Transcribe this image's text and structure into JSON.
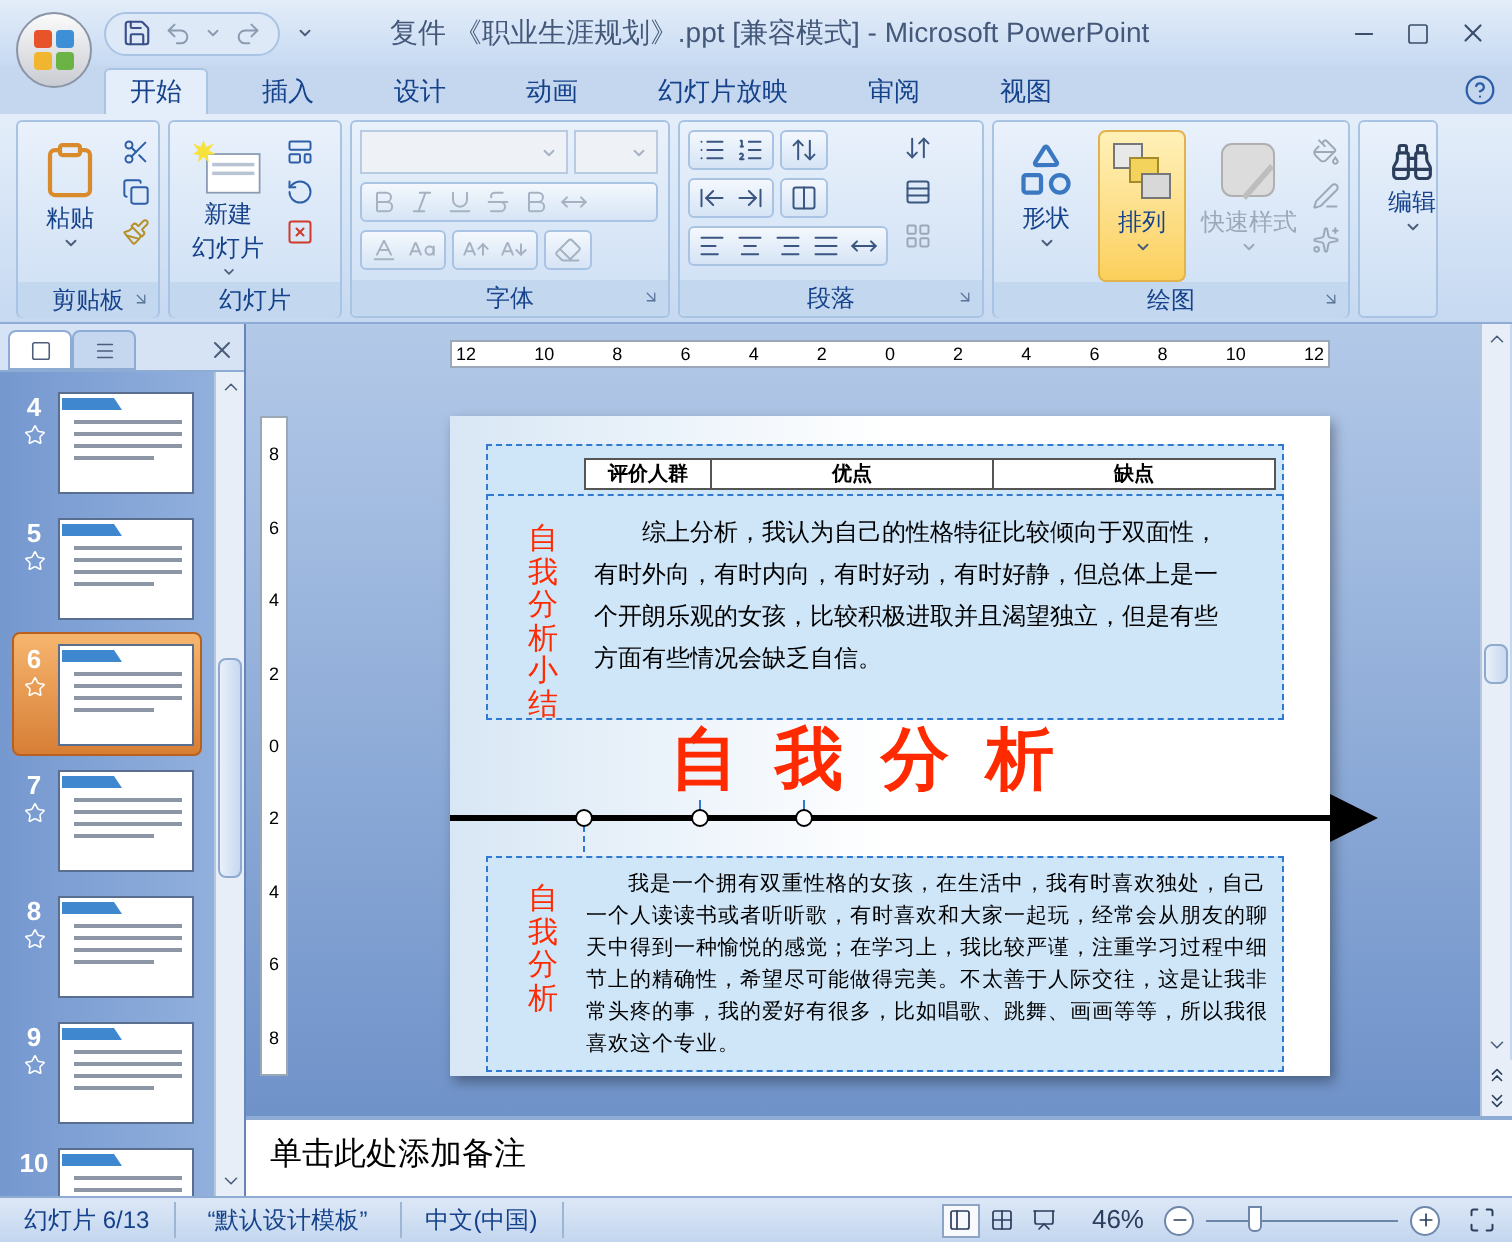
{
  "window": {
    "title": "复件 《职业生涯规划》.ppt [兼容模式] - Microsoft PowerPoint"
  },
  "tabs": [
    {
      "label": "开始",
      "selected": true
    },
    {
      "label": "插入",
      "selected": false
    },
    {
      "label": "设计",
      "selected": false
    },
    {
      "label": "动画",
      "selected": false
    },
    {
      "label": "幻灯片放映",
      "selected": false
    },
    {
      "label": "审阅",
      "selected": false
    },
    {
      "label": "视图",
      "selected": false
    }
  ],
  "ribbon": [
    {
      "kind": "clipboard",
      "label": "剪贴板",
      "buttons": [
        {
          "lines": [
            "粘贴"
          ],
          "highlighted": false,
          "disabled": false
        }
      ]
    },
    {
      "kind": "slides",
      "label": "幻灯片",
      "buttons": [
        {
          "lines": [
            "新建",
            "幻灯片"
          ],
          "highlighted": false,
          "disabled": false
        }
      ]
    },
    {
      "kind": "font",
      "label": "字体",
      "disabled": true
    },
    {
      "kind": "paragraph",
      "label": "段落"
    },
    {
      "kind": "drawing",
      "label": "绘图",
      "buttons": [
        {
          "lines": [
            "形状"
          ],
          "highlighted": false,
          "disabled": false
        },
        {
          "lines": [
            "排列"
          ],
          "highlighted": true,
          "disabled": false
        },
        {
          "lines": [
            "快速样式"
          ],
          "highlighted": false,
          "disabled": true
        }
      ]
    },
    {
      "kind": "editing",
      "buttons": [
        {
          "lines": [
            "编辑"
          ],
          "highlighted": false,
          "disabled": false
        }
      ]
    }
  ],
  "slide_panel": {
    "thumbnails": [
      {
        "number": "4",
        "selected": false,
        "animated": true
      },
      {
        "number": "5",
        "selected": false,
        "animated": true
      },
      {
        "number": "6",
        "selected": true,
        "animated": true
      },
      {
        "number": "7",
        "selected": false,
        "animated": true
      },
      {
        "number": "8",
        "selected": false,
        "animated": true
      },
      {
        "number": "9",
        "selected": false,
        "animated": true
      },
      {
        "number": "10",
        "selected": false,
        "animated": false
      }
    ]
  },
  "ruler": {
    "horizontal": [
      "12",
      "10",
      "8",
      "6",
      "4",
      "2",
      "0",
      "2",
      "4",
      "6",
      "8",
      "10",
      "12"
    ],
    "vertical": [
      "8",
      "6",
      "4",
      "2",
      "0",
      "2",
      "4",
      "6",
      "8"
    ]
  },
  "slide": {
    "summary_box": {
      "table_headers": [
        "评价人群",
        "优点",
        "缺点"
      ],
      "side_label": "自我分析小结",
      "text": "综上分析，我认为自己的性格特征比较倾向于双面性，有时外向，有时内向，有时好动，有时好静，但总体上是一个开朗乐观的女孩，比较积极进取并且渴望独立，但是有些方面有些情况会缺乏自信。"
    },
    "title": "自我分析",
    "analysis_box": {
      "side_label": "自我分析",
      "text": "我是一个拥有双重性格的女孩，在生活中，我有时喜欢独处，自己一个人读读书或者听听歌，有时喜欢和大家一起玩，经常会从朋友的聊天中得到一种愉悦的感觉；在学习上，我比较严谨，注重学习过程中细节上的精确性，希望尽可能做得完美。不太善于人际交往，这是让我非常头疼的事，我的爱好有很多，比如唱歌、跳舞、画画等等，所以我很喜欢这个专业。"
    }
  },
  "notes": {
    "placeholder": "单击此处添加备注"
  },
  "status_bar": {
    "slide_counter": "幻灯片 6/13",
    "theme": "“默认设计模板”",
    "language": "中文(中国)",
    "view_buttons": [
      {
        "kind": "normal",
        "selected": true
      },
      {
        "kind": "sorter",
        "selected": false
      },
      {
        "kind": "slideshow",
        "selected": false
      }
    ],
    "zoom": {
      "reading": "46%",
      "level": 0.25
    }
  }
}
